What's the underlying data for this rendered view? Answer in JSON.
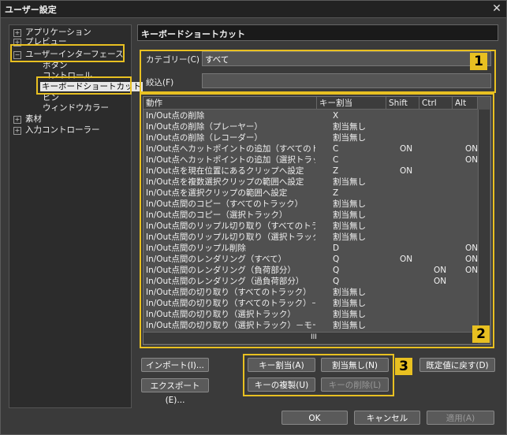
{
  "window": {
    "title": "ユーザー設定",
    "close_glyph": "✕"
  },
  "tree": {
    "items": [
      {
        "label": "アプリケーション",
        "expander": "+"
      },
      {
        "label": "プレビュー",
        "expander": "+"
      },
      {
        "label": "ユーザーインターフェース",
        "expander": "−"
      },
      {
        "label": "ボタン"
      },
      {
        "label": "コントロール"
      },
      {
        "label": "キーボードショートカット"
      },
      {
        "label": "ビン"
      },
      {
        "label": "ウィンドウカラー"
      },
      {
        "label": "素材",
        "expander": "+"
      },
      {
        "label": "入力コントローラー",
        "expander": "+"
      }
    ]
  },
  "panel": {
    "title": "キーボードショートカット"
  },
  "filters": {
    "category_label": "カテゴリー(C)",
    "category_value": "すべて",
    "narrow_label": "絞込(F)",
    "narrow_value": ""
  },
  "table": {
    "columns": [
      "動作",
      "キー割当",
      "Shift",
      "Ctrl",
      "Alt"
    ],
    "rows": [
      [
        "In/Out点の削除",
        "X",
        "",
        "",
        ""
      ],
      [
        "In/Out点の削除（プレーヤー）",
        "割当無し",
        "",
        "",
        ""
      ],
      [
        "In/Out点の削除（レコーダー）",
        "割当無し",
        "",
        "",
        ""
      ],
      [
        "In/Out点へカットポイントの追加（すべてのトラ...",
        "C",
        "ON",
        "",
        "ON"
      ],
      [
        "In/Out点へカットポイントの追加（選択トラック）",
        "C",
        "",
        "",
        "ON"
      ],
      [
        "In/Out点を現在位置にあるクリップへ設定",
        "Z",
        "ON",
        "",
        ""
      ],
      [
        "In/Out点を複数選択クリップの範囲へ設定",
        "割当無し",
        "",
        "",
        ""
      ],
      [
        "In/Out点を選択クリップの範囲へ設定",
        "Z",
        "",
        "",
        ""
      ],
      [
        "In/Out点間のコピー（すべてのトラック）",
        "割当無し",
        "",
        "",
        ""
      ],
      [
        "In/Out点間のコピー（選択トラック）",
        "割当無し",
        "",
        "",
        ""
      ],
      [
        "In/Out点間のリップル切り取り（すべてのトラッ...",
        "割当無し",
        "",
        "",
        ""
      ],
      [
        "In/Out点間のリップル切り取り（選択トラック）",
        "割当無し",
        "",
        "",
        ""
      ],
      [
        "In/Out点間のリップル削除",
        "D",
        "",
        "",
        "ON"
      ],
      [
        "In/Out点間のレンダリング（すべて）",
        "Q",
        "ON",
        "",
        "ON"
      ],
      [
        "In/Out点間のレンダリング（負荷部分）",
        "Q",
        "",
        "ON",
        "ON"
      ],
      [
        "In/Out点間のレンダリング（過負荷部分）",
        "Q",
        "",
        "ON",
        ""
      ],
      [
        "In/Out点間の切り取り（すべてのトラック）",
        "割当無し",
        "",
        "",
        ""
      ],
      [
        "In/Out点間の切り取り（すべてのトラック）－モ...",
        "割当無し",
        "",
        "",
        ""
      ],
      [
        "In/Out点間の切り取り（選択トラック）",
        "割当無し",
        "",
        "",
        ""
      ],
      [
        "In/Out点間の切り取り（選択トラック）－モー...",
        "割当無し",
        "",
        "",
        ""
      ]
    ],
    "hscroll_grip": "III"
  },
  "buttons": {
    "import": "インポート(I)...",
    "export": "エクスポート(E)...",
    "assign": "キー割当(A)",
    "unassign": "割当無し(N)",
    "duplicate": "キーの複製(U)",
    "delete_key": "キーの削除(L)",
    "defaults": "既定値に戻す(D)",
    "ok": "OK",
    "cancel": "キャンセル",
    "apply": "適用(A)"
  },
  "callouts": [
    "1",
    "2",
    "3"
  ],
  "accent_color": "#e8c021"
}
